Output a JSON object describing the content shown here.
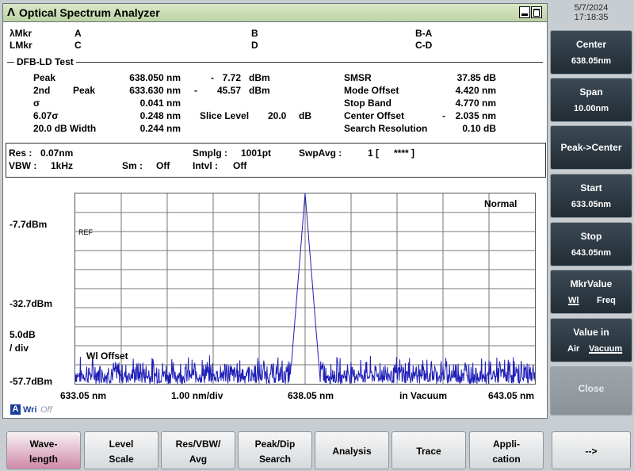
{
  "window": {
    "logo": "Λ",
    "title": "Optical Spectrum Analyzer"
  },
  "datetime": {
    "date": "5/7/2024",
    "time": "17:18:35"
  },
  "markers": {
    "row1": {
      "label": "λMkr",
      "a": "A",
      "b": "B",
      "ba": "B-A"
    },
    "row2": {
      "label": "LMkr",
      "c": "C",
      "d": "D",
      "cd": "C-D"
    }
  },
  "test_title": "DFB-LD Test",
  "results": {
    "peak": {
      "label": "Peak",
      "wl": "638.050 nm",
      "sign": "-",
      "level": "7.72",
      "unit": "dBm"
    },
    "peak2": {
      "label1": "2nd",
      "label2": "Peak",
      "wl": "633.630 nm",
      "sign": "-",
      "level": "45.57",
      "unit": "dBm"
    },
    "sigma": {
      "label": "σ",
      "value": "0.041 nm"
    },
    "sigma607": {
      "label": "6.07σ",
      "value": "0.248 nm"
    },
    "width20": {
      "label": "20.0  dB Width",
      "value": "0.244 nm"
    },
    "slice": {
      "label": "Slice Level",
      "value": "20.0",
      "unit": "dB"
    },
    "smsr": {
      "label": "SMSR",
      "value": "37.85 dB"
    },
    "mode_offset": {
      "label": "Mode Offset",
      "value": "4.420 nm"
    },
    "stop_band": {
      "label": "Stop Band",
      "value": "4.770 nm"
    },
    "center_offset": {
      "label": "Center Offset",
      "sign": "-",
      "value": "2.035 nm"
    },
    "search_res": {
      "label": "Search Resolution",
      "value": "0.10  dB"
    }
  },
  "settings": {
    "res_label": "Res :",
    "res_value": "0.07nm",
    "vbw_label": "VBW :",
    "vbw_value": "1kHz",
    "sm_label": "Sm :",
    "sm_value": "Off",
    "smplg_label": "Smplg :",
    "smplg_value": "1001pt",
    "intvl_label": "Intvl :",
    "intvl_value": "Off",
    "swpavg_label": "SwpAvg :",
    "swpavg_value": "1 [",
    "swpavg_stars": "****  ]"
  },
  "plot": {
    "mode": "Normal",
    "ref_marker": "REF",
    "wl_offset": "Wl Offset",
    "y_top": "-7.7dBm",
    "y_mid": "-32.7dBm",
    "y_scale1": "5.0dB",
    "y_scale2": "/ div",
    "y_bottom": "-57.7dBm",
    "x_start": "633.05 nm",
    "x_div": "1.00 nm/div",
    "x_center": "638.05 nm",
    "x_medium": "in Vacuum",
    "x_stop": "643.05 nm",
    "trace_color": "#1f1fb8",
    "chart_data": {
      "type": "line",
      "x_range_nm": [
        633.05,
        643.05
      ],
      "y_range_dbm": [
        -57.7,
        -7.7
      ],
      "peak_x_nm": 638.05,
      "peak_y_dbm": -7.72,
      "noise_floor_dbm": [
        -57.7,
        -50.0
      ]
    }
  },
  "write": {
    "badge": "A",
    "label": "Wri",
    "state": "Off"
  },
  "softkeys": {
    "center": {
      "label": "Center",
      "value": "638.05nm"
    },
    "span": {
      "label": "Span",
      "value": "10.00nm"
    },
    "peak_center": {
      "label": "Peak->Center"
    },
    "start": {
      "label": "Start",
      "value": "633.05nm"
    },
    "stop": {
      "label": "Stop",
      "value": "643.05nm"
    },
    "mkr_value": {
      "label": "MkrValue",
      "opt1": "Wl",
      "opt2": "Freq"
    },
    "value_in": {
      "label": "Value in",
      "opt1": "Air",
      "opt2": "Vacuum"
    },
    "close": {
      "label": "Close"
    }
  },
  "function_keys": [
    {
      "l1": "Wave-",
      "l2": "length"
    },
    {
      "l1": "Level",
      "l2": "Scale"
    },
    {
      "l1": "Res/VBW/",
      "l2": "Avg"
    },
    {
      "l1": "Peak/Dip",
      "l2": "Search"
    },
    {
      "l1": "Analysis"
    },
    {
      "l1": "Trace"
    },
    {
      "l1": "Appli-",
      "l2": "cation"
    },
    {
      "l1": "-->"
    }
  ]
}
